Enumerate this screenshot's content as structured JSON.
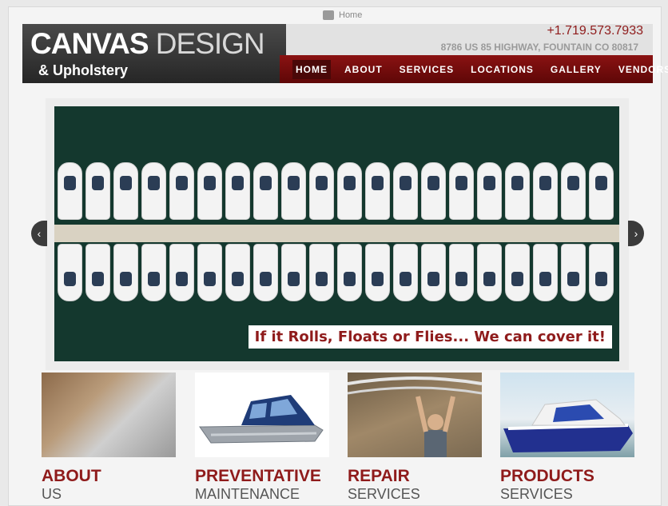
{
  "breadcrumb": {
    "label": "Home"
  },
  "header": {
    "logo_line1_bold": "CANVAS",
    "logo_line1_light": "DESIGN",
    "logo_line2": "& Upholstery",
    "phone": "+1.719.573.7933",
    "address": "8786 US 85 HIGHWAY, FOUNTAIN CO 80817"
  },
  "nav": {
    "items": [
      {
        "label": "HOME"
      },
      {
        "label": "ABOUT"
      },
      {
        "label": "SERVICES"
      },
      {
        "label": "LOCATIONS"
      },
      {
        "label": "GALLERY"
      },
      {
        "label": "VENDORS"
      }
    ]
  },
  "slider": {
    "tagline": "If it Rolls, Floats or Flies... We can cover it!",
    "prev_arrow": "‹",
    "next_arrow": "›"
  },
  "features": [
    {
      "title": "ABOUT",
      "subtitle": "US"
    },
    {
      "title": "PREVENTATIVE",
      "subtitle": "MAINTENANCE"
    },
    {
      "title": "REPAIR",
      "subtitle": "SERVICES"
    },
    {
      "title": "PRODUCTS",
      "subtitle": "SERVICES"
    }
  ],
  "colors": {
    "brand_red": "#8f1b1b",
    "nav_red": "#7a0e0e",
    "logo_dark": "#333333"
  }
}
